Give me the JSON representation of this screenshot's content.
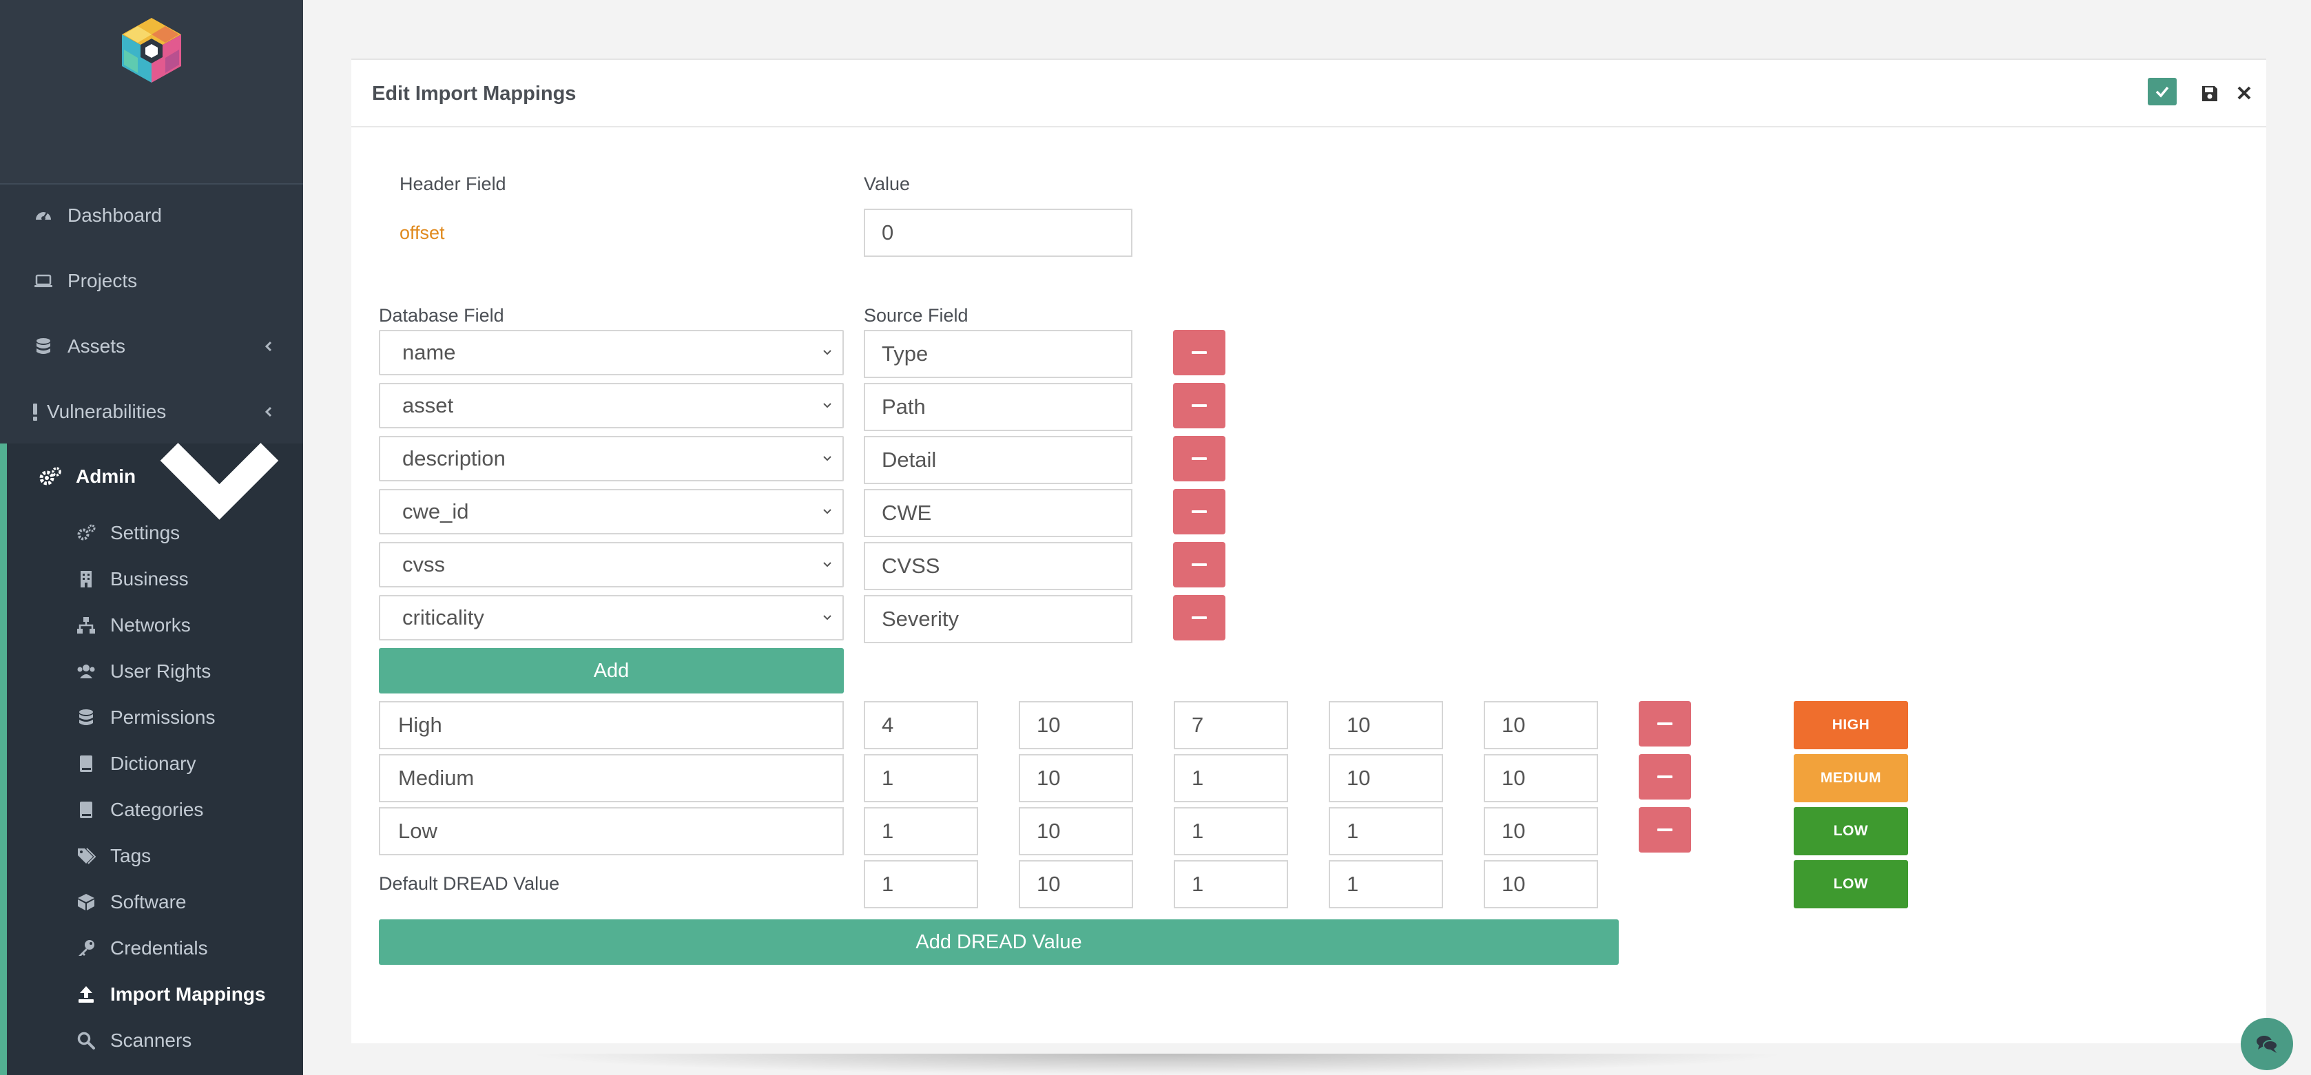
{
  "colors": {
    "sidebar_bg": "#2e3742",
    "accent_green": "#53b092",
    "danger_red": "#df6b74",
    "high": "#ef6e2d",
    "medium": "#f2a23b",
    "low": "#3e9a2f",
    "offset_orange": "#e08a1e"
  },
  "sidebar": {
    "logo_icon": "hexagon-cube-logo",
    "items": [
      {
        "label": "Dashboard",
        "icon": "gauge-icon"
      },
      {
        "label": "Projects",
        "icon": "laptop-icon"
      },
      {
        "label": "Assets",
        "icon": "database-icon"
      },
      {
        "label": "Vulnerabilities",
        "icon": "exclamation-icon"
      }
    ],
    "admin": {
      "label": "Admin",
      "icon": "cogs-icon",
      "sub_items": [
        {
          "label": "Settings",
          "icon": "cogs-icon"
        },
        {
          "label": "Business",
          "icon": "building-icon"
        },
        {
          "label": "Networks",
          "icon": "sitemap-icon"
        },
        {
          "label": "User Rights",
          "icon": "users-icon"
        },
        {
          "label": "Permissions",
          "icon": "database-icon"
        },
        {
          "label": "Dictionary",
          "icon": "book-icon"
        },
        {
          "label": "Categories",
          "icon": "book-icon"
        },
        {
          "label": "Tags",
          "icon": "tags-icon"
        },
        {
          "label": "Software",
          "icon": "cubes-icon"
        },
        {
          "label": "Credentials",
          "icon": "key-icon"
        },
        {
          "label": "Import Mappings",
          "icon": "upload-icon"
        },
        {
          "label": "Scanners",
          "icon": "search-icon"
        }
      ]
    }
  },
  "panel": {
    "title": "Edit Import Mappings",
    "header_field_label": "Header Field",
    "value_label": "Value",
    "header_field_value": "offset",
    "header_value": "0",
    "database_field_label": "Database Field",
    "source_field_label": "Source Field",
    "mappings": [
      {
        "db": "name",
        "source": "Type"
      },
      {
        "db": "asset",
        "source": "Path"
      },
      {
        "db": "description",
        "source": "Detail"
      },
      {
        "db": "cwe_id",
        "source": "CWE"
      },
      {
        "db": "cvss",
        "source": "CVSS"
      },
      {
        "db": "criticality",
        "source": "Severity"
      }
    ],
    "add_label": "Add",
    "dread_rows": [
      {
        "name": "High",
        "values": [
          "4",
          "10",
          "7",
          "10",
          "10"
        ],
        "badge": "HIGH"
      },
      {
        "name": "Medium",
        "values": [
          "1",
          "10",
          "1",
          "10",
          "10"
        ],
        "badge": "MEDIUM"
      },
      {
        "name": "Low",
        "values": [
          "1",
          "10",
          "1",
          "1",
          "10"
        ],
        "badge": "LOW"
      }
    ],
    "default_dread_label": "Default DREAD Value",
    "default_dread_values": [
      "1",
      "10",
      "1",
      "1",
      "10"
    ],
    "default_dread_badge": "LOW",
    "add_dread_label": "Add DREAD Value"
  }
}
